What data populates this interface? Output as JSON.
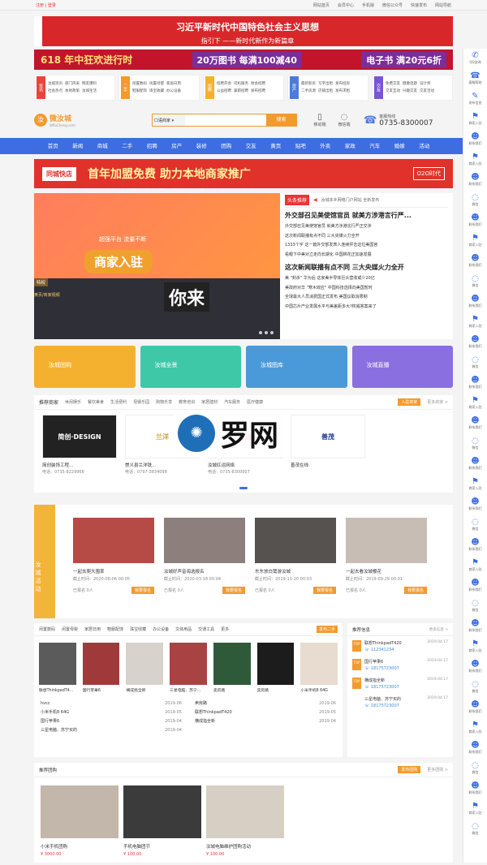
{
  "topbar": {
    "left": "注册 | 登录",
    "links": [
      "网站首页",
      "会员中心",
      "手机版",
      "微信公众号",
      "快速发布",
      "网站导航"
    ]
  },
  "banner1": {
    "line1": "习近平新时代中国特色社会主义思想",
    "line2": "指引下 ——新时代新作为新篇章"
  },
  "banner2": {
    "sale": "618 年中狂欢进行时",
    "offer1": "20万图书 每满100减40",
    "offer2": "电子书 满20元6折"
  },
  "categories": [
    {
      "icon": "资讯",
      "color": "#e8453c",
      "links": [
        "汝城资讯",
        "部门风采",
        "网友爆料",
        "社会热点",
        "本地政策",
        "汝城生活"
      ]
    },
    {
      "icon": "二手",
      "color": "#f29a2e",
      "links": [
        "闲置数码",
        "闲置母婴",
        "家居日用",
        "鞋服配饰",
        "珠宝收藏",
        "办公设备"
      ]
    },
    {
      "icon": "招聘",
      "color": "#f4b12f",
      "links": [
        "招聘开会",
        "司机服务",
        "财会招聘",
        "公益招聘",
        "兼职招聘",
        "发布招聘"
      ]
    },
    {
      "icon": "房产",
      "color": "#4a7cd9",
      "links": [
        "最新新房",
        "写字出租",
        "发布招房",
        "二手房源",
        "店铺出租",
        "发布求租"
      ]
    },
    {
      "icon": "交友",
      "color": "#7a55d3",
      "links": [
        "免费交友",
        "健康话题",
        "设计师",
        "交友互动",
        "兴趣交友",
        "交友活动"
      ]
    }
  ],
  "header": {
    "logo": "微汝城",
    "logo_sub": "WRuCheng.com",
    "search_type": "口语商家",
    "search_btn": "搜索",
    "mobile": "移动端",
    "wechat": "微信端",
    "hotline_label": "客服热线",
    "hotline": "0735-8300007"
  },
  "nav": [
    "首页",
    "新闻",
    "商城",
    "二手",
    "招聘",
    "房产",
    "装修",
    "团购",
    "交友",
    "黄页",
    "贴吧",
    "外卖",
    "家政",
    "汽车",
    "婚嫁",
    "活动"
  ],
  "banner3": {
    "shop": "同城快店",
    "slogan": "首年加盟免费 助力本地商家推广",
    "tag": "O2O时代"
  },
  "slide": {
    "top": "超强平台 流量不断",
    "main": "商家入驻",
    "tag": "特权",
    "sub": "黄页/商家视频",
    "sign": "你来"
  },
  "news": {
    "badge": "头条推荐",
    "sub": "汝城本乡网络门户网站 全新发布",
    "h1": "外交部召见美使馆官员 就美方涉港言行严...",
    "list1": [
      "外交部召见美使馆官员 就美方涉港言行严正交涉",
      "这次新闻联播有点不同 三大央媒火力全开",
      "1333个字 这一篇外交部发表人连续抨击这位美国官",
      "看眼下中美对立走向长期化 中国棉花正加速发展"
    ],
    "h2": "这次新闻联播有点不同 三大央媒火力全开",
    "list2": [
      "美 \"封杀\" 华为后 这家美半导体巨头营收或少20亿",
      "美政府对华 \"寒木效应\" 中国科技选择向美国暂时",
      "全球最大人员消费国正式发布 美国议取消限制",
      "中国芯片产业发展水平与美差距多大?权威答案来了"
    ]
  },
  "tiles": [
    {
      "label": "汝城团购",
      "color": "#f4b12f"
    },
    {
      "label": "汝城全景",
      "color": "#3fc8a8"
    },
    {
      "label": "汝城图库",
      "color": "#4a9ad9"
    },
    {
      "label": "汝城直播",
      "color": "#8a6fe0"
    }
  ],
  "merchants": {
    "title": "推荐商家",
    "tabs": [
      "休闲娱乐",
      "餐饮美食",
      "生活便利",
      "母婴乐园",
      "购物乐享",
      "教育培训",
      "家居建材",
      "汽车服务",
      "医疗健康"
    ],
    "btn": "入驻商家",
    "more": "更多商家 >",
    "items": [
      {
        "name": "简创装饰工程...",
        "phone": "电话：0735-8229966",
        "logo": "简创·DESIGN"
      },
      {
        "name": "崇义县兰洋铁...",
        "phone": "电话：0797-3834098",
        "logo": "兰洋"
      },
      {
        "name": "汝城红运网络",
        "phone": "电话：0735-8300007",
        "logo": "红运"
      },
      {
        "name": "善茂在线",
        "phone": "",
        "logo": "善茂"
      }
    ]
  },
  "watermark": {
    "text": "罗网"
  },
  "activities": {
    "side": "汝城活动",
    "items": [
      {
        "name": "一起去爬大围率",
        "date": "截止时间：2020-08-06 00:05",
        "count": "已报名 0人",
        "btn": "我要报名"
      },
      {
        "name": "汝城好声音海选报名",
        "date": "截止时间：2020-03-18 00:04",
        "count": "已报名 0人",
        "btn": "我要报名"
      },
      {
        "name": "东东放白鹭游汝城",
        "date": "截止时间：2019-11-20 00:03",
        "count": "已报名 0人",
        "btn": "我要报名"
      },
      {
        "name": "一起去看汝城樱花",
        "date": "截止时间：2019-09-29 00:01",
        "count": "已报名 0人",
        "btn": "我要报名"
      }
    ]
  },
  "trade": {
    "tabs": [
      "闲置数码",
      "闲置母婴",
      "家居日用",
      "鞋服配饰",
      "珠宝收藏",
      "办公设备",
      "文体用品",
      "交通工具",
      "更多"
    ],
    "btn": "发布二手",
    "prods": [
      "联想ThinkpadT4...",
      "国行苹果6",
      "横成指全新",
      "三星电脑、苏宁...",
      "卖房路",
      "卖房路",
      "小米手机8 64G"
    ],
    "list": [
      {
        "n": "hvcc",
        "d": "2019-06"
      },
      {
        "n": "卖房路",
        "d": "2019-06"
      },
      {
        "n": "小米手机8 64G",
        "d": "2019-05"
      },
      {
        "n": "联想ThinkpadT420",
        "d": "2019-05"
      },
      {
        "n": "国行苹果6",
        "d": "2019-04"
      },
      {
        "n": "横成指全新",
        "d": "2019-04"
      },
      {
        "n": "三星电脑、苏宁买的",
        "d": "2019-04"
      },
      {
        "n": "",
        "d": ""
      }
    ]
  },
  "recommend": {
    "title": "推荐信息",
    "more": "更多信息 >",
    "items": [
      {
        "b": "TOP",
        "t": "联想ThinkpadT420",
        "ph": "112341234",
        "d": "2019.04.17"
      },
      {
        "b": "TOP",
        "t": "国行苹果6",
        "ph": "18175723007",
        "d": "2019.04.17"
      },
      {
        "b": "TOP",
        "t": "横成指全新",
        "ph": "18175723007",
        "d": "2019.04.17"
      },
      {
        "b": "",
        "t": "三星电脑、苏宁买的",
        "ph": "18175723007",
        "d": "2019.04.17"
      }
    ]
  },
  "group": {
    "title": "推荐团购",
    "btn": "发布团购",
    "more": "更多团购 >",
    "items": [
      {
        "name": "小米手机团购",
        "price": "¥ 3000.00"
      },
      {
        "name": "手机电脑团节",
        "price": "¥ 100.00"
      },
      {
        "name": "汝城电脑维护团购活动",
        "price": "¥ 100.00"
      }
    ]
  },
  "rail": [
    "QQ咨询",
    "客服帮助",
    "发布信息",
    "商家入驻",
    "联系我们",
    "商家入驻",
    "联系我们",
    "微信",
    "联系我们",
    "商家入驻",
    "联系我们",
    "微信",
    "联系我们",
    "商家入驻",
    "联系我们",
    "微信",
    "联系我们",
    "商家入驻",
    "联系我们",
    "微信",
    "联系我们",
    "商家入驻",
    "联系我们",
    "微信",
    "联系我们",
    "商家入驻",
    "联系我们",
    "微信",
    "联系我们",
    "商家入驻",
    "联系我们",
    "微信",
    "联系我们",
    "商家入驻",
    "联系我们",
    "微信",
    "联系我们",
    "商家入驻",
    "微信"
  ]
}
